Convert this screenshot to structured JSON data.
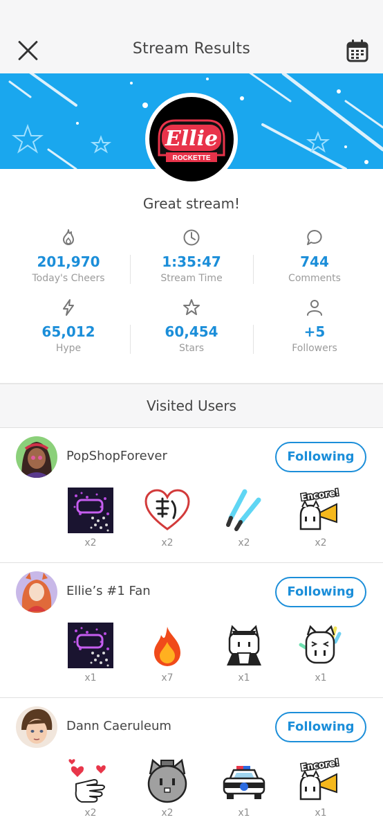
{
  "header": {
    "title": "Stream Results"
  },
  "banner": {
    "logo_primary": "Ellie",
    "logo_secondary": "ROCKETTE",
    "colors": {
      "banner": "#1aa7ee",
      "accent": "#1b8ed9"
    }
  },
  "tagline": "Great stream!",
  "stats": [
    {
      "icon": "flame-icon",
      "value": "201,970",
      "label": "Today's Cheers"
    },
    {
      "icon": "clock-icon",
      "value": "1:35:47",
      "label": "Stream Time"
    },
    {
      "icon": "comment-icon",
      "value": "744",
      "label": "Comments"
    },
    {
      "icon": "lightning-icon",
      "value": "65,012",
      "label": "Hype"
    },
    {
      "icon": "star-icon",
      "value": "60,454",
      "label": "Stars"
    },
    {
      "icon": "person-icon",
      "value": "+5",
      "label": "Followers"
    }
  ],
  "visited": {
    "title": "Visited Users",
    "users": [
      {
        "name": "PopShopForever",
        "follow_label": "Following",
        "gifts": [
          {
            "icon": "glitter-logo-gift-icon",
            "count": "x2"
          },
          {
            "icon": "heart-kanji-gift-icon",
            "count": "x2"
          },
          {
            "icon": "glowsticks-gift-icon",
            "count": "x2"
          },
          {
            "icon": "encore-megaphone-gift-icon",
            "count": "x2",
            "text": "Encore!"
          }
        ]
      },
      {
        "name": "Ellie’s #1 Fan",
        "follow_label": "Following",
        "gifts": [
          {
            "icon": "glitter-logo-gift-icon",
            "count": "x1"
          },
          {
            "icon": "fire-gift-icon",
            "count": "x7"
          },
          {
            "icon": "maid-cat-gift-icon",
            "count": "x1"
          },
          {
            "icon": "cheer-cat-gift-icon",
            "count": "x1"
          }
        ]
      },
      {
        "name": "Dann Caeruleum",
        "follow_label": "Following",
        "gifts": [
          {
            "icon": "hand-hearts-gift-icon",
            "count": "x2"
          },
          {
            "icon": "robot-cat-gift-icon",
            "count": "x2"
          },
          {
            "icon": "police-car-gift-icon",
            "count": "x1"
          },
          {
            "icon": "encore-megaphone-gift-icon",
            "count": "x1",
            "text": "Encore!"
          }
        ]
      }
    ]
  }
}
